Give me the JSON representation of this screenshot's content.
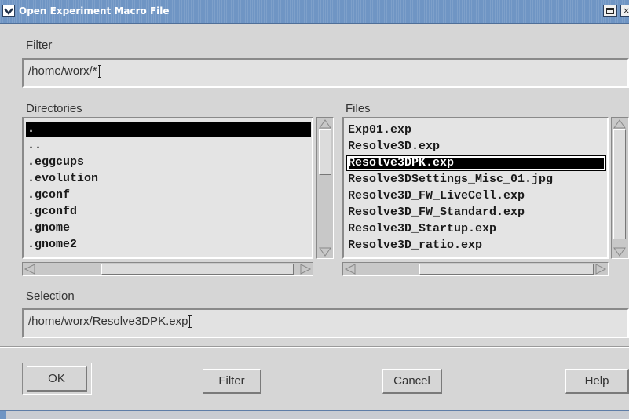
{
  "window": {
    "title": "Open Experiment Macro File"
  },
  "filter": {
    "label": "Filter",
    "value": "/home/worx/*"
  },
  "directories": {
    "label": "Directories",
    "items": [
      ".",
      "..",
      ".eggcups",
      ".evolution",
      ".gconf",
      ".gconfd",
      ".gnome",
      ".gnome2"
    ],
    "selected_index": 0
  },
  "files": {
    "label": "Files",
    "items": [
      "Exp01.exp",
      "Resolve3D.exp",
      "Resolve3DPK.exp",
      "Resolve3DSettings_Misc_01.jpg",
      "Resolve3D_FW_LiveCell.exp",
      "Resolve3D_FW_Standard.exp",
      "Resolve3D_Startup.exp",
      "Resolve3D_ratio.exp"
    ],
    "selected_index": 2
  },
  "selection": {
    "label": "Selection",
    "value": "/home/worx/Resolve3DPK.exp"
  },
  "buttons": {
    "ok": "OK",
    "filter": "Filter",
    "cancel": "Cancel",
    "help": "Help"
  },
  "colors": {
    "titlebar": "#6f95c4",
    "dialog_bg": "#d6d6d6",
    "selection_bg": "#000000"
  }
}
